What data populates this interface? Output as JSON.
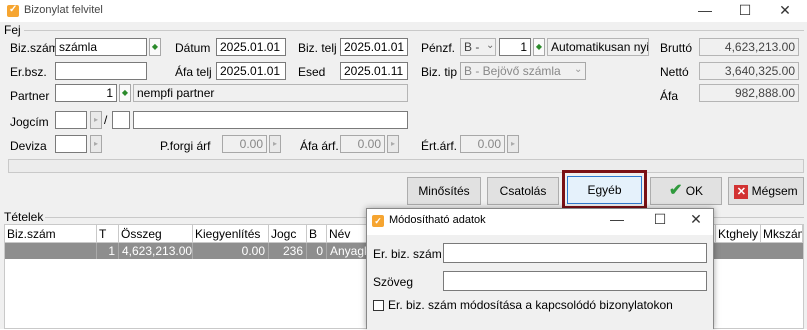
{
  "window": {
    "title": "Bizonylat felvitel",
    "minimize": "—",
    "maximize": "☐",
    "close": "✕"
  },
  "fej": {
    "section_label": "Fej"
  },
  "form": {
    "biz_szam_label": "Biz.szám",
    "biz_szam_value": "számla",
    "datum_label": "Dátum",
    "datum_value": "2025.01.01",
    "biz_telj_label": "Biz. telj",
    "biz_telj_value": "2025.01.01",
    "penzf_label": "Pénzf.",
    "penzf_value": "B - ",
    "penzf_num": "1",
    "penzf_text": "Automatikusan nyito",
    "brutto_label": "Bruttó",
    "brutto_value": "4,623,213.00",
    "er_bsz_label": "Er.bsz.",
    "er_bsz_value": "",
    "afa_telj_label": "Áfa telj",
    "afa_telj_value": "2025.01.01",
    "esed_label": "Esed",
    "esed_value": "2025.01.11",
    "biz_tip_label": "Biz. tip",
    "biz_tip_value": "B - Bejövő számla",
    "netto_label": "Nettó",
    "netto_value": "3,640,325.00",
    "partner_label": "Partner",
    "partner_num": "1",
    "partner_name": "nempfi partner",
    "afa_label": "Áfa",
    "afa_value": "982,888.00",
    "jogcim_label": "Jogcím",
    "jogcim_sep": "/",
    "deviza_label": "Deviza",
    "pforgi_label": "P.forgi árf",
    "pforgi_value": "0.00",
    "afa_arf_label": "Áfa árf.",
    "afa_arf_value": "0.00",
    "ert_arf_label": "Ért.árf.",
    "ert_arf_value": "0.00"
  },
  "buttons": {
    "minosites": "Minősítés",
    "csatolas": "Csatolás",
    "egyeb": "Egyéb",
    "ok": "OK",
    "megsem": "Mégsem"
  },
  "tetelek": {
    "section_label": "Tételek",
    "columns": [
      "Biz.szám",
      "T",
      "Összeg",
      "Kiegyenlítés",
      "Jogc",
      "B",
      "Név"
    ],
    "right_columns": [
      "Ktghely",
      "Mkszám"
    ],
    "row": [
      "",
      "1",
      "4,623,213.00",
      "0.00",
      "236",
      "0",
      "Anyagk"
    ]
  },
  "dialog": {
    "title": "Módosítható adatok",
    "er_biz_label": "Er. biz. szám",
    "er_biz_value": "",
    "szoveg_label": "Szöveg",
    "szoveg_value": "",
    "checkbox_label": "Er. biz. szám módosítása a kapcsolódó bizonylatokon"
  },
  "colors": {
    "accent": "#f6a531",
    "ok_green": "#2f9a3c",
    "cancel_red": "#d23232",
    "highlight": "#7b1015",
    "sel_row": "#8e8e8e"
  }
}
